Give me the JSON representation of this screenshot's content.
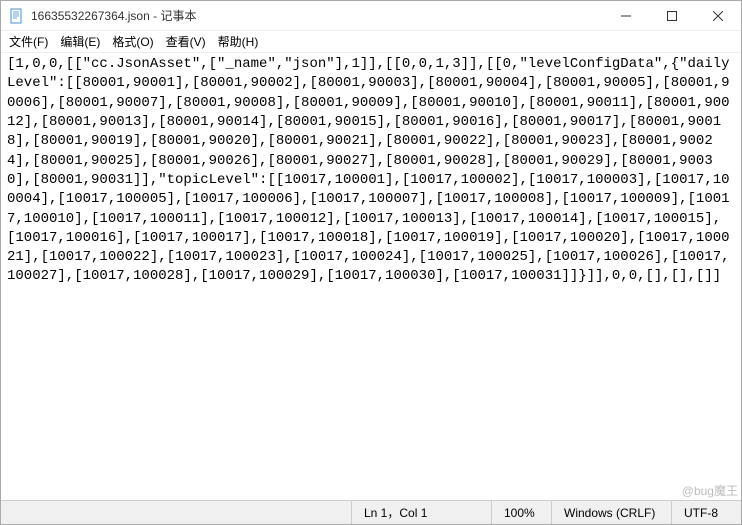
{
  "window": {
    "title": "16635532267364.json - 记事本"
  },
  "menu": {
    "file": "文件(F)",
    "edit": "编辑(E)",
    "format": "格式(O)",
    "view": "查看(V)",
    "help": "帮助(H)"
  },
  "content": {
    "text": "[1,0,0,[[\"cc.JsonAsset\",[\"_name\",\"json\"],1]],[[0,0,1,3]],[[0,\"levelConfigData\",{\"dailyLevel\":[[80001,90001],[80001,90002],[80001,90003],[80001,90004],[80001,90005],[80001,90006],[80001,90007],[80001,90008],[80001,90009],[80001,90010],[80001,90011],[80001,90012],[80001,90013],[80001,90014],[80001,90015],[80001,90016],[80001,90017],[80001,90018],[80001,90019],[80001,90020],[80001,90021],[80001,90022],[80001,90023],[80001,90024],[80001,90025],[80001,90026],[80001,90027],[80001,90028],[80001,90029],[80001,90030],[80001,90031]],\"topicLevel\":[[10017,100001],[10017,100002],[10017,100003],[10017,100004],[10017,100005],[10017,100006],[10017,100007],[10017,100008],[10017,100009],[10017,100010],[10017,100011],[10017,100012],[10017,100013],[10017,100014],[10017,100015],[10017,100016],[10017,100017],[10017,100018],[10017,100019],[10017,100020],[10017,100021],[10017,100022],[10017,100023],[10017,100024],[10017,100025],[10017,100026],[10017,100027],[10017,100028],[10017,100029],[10017,100030],[10017,100031]]}]],0,0,[],[],[]]"
  },
  "status": {
    "position": "Ln 1，Col 1",
    "zoom": "100%",
    "line_ending": "Windows (CRLF)",
    "encoding": "UTF-8"
  },
  "watermark": "@bug魔王"
}
